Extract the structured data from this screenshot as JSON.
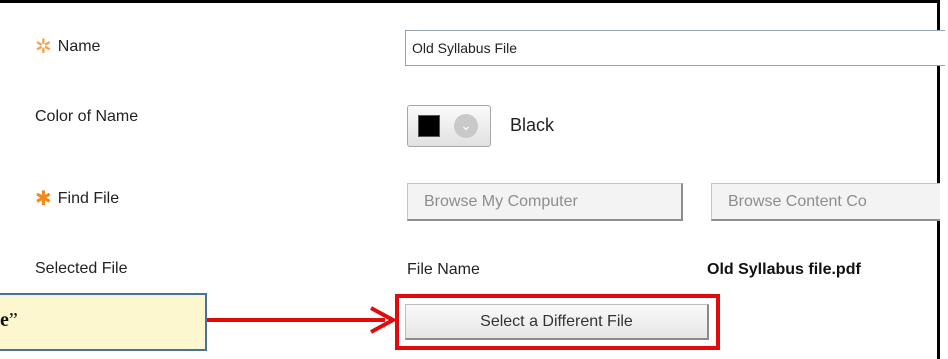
{
  "form": {
    "name_label": "Name",
    "name_value": "Old Syllabus File",
    "color_label": "Color of Name",
    "color_value": "Black",
    "color_swatch": "#000000",
    "find_file_label": "Find File",
    "browse_my_computer": "Browse My Computer",
    "browse_content": "Browse Content Co",
    "selected_file_label": "Selected File",
    "file_name_label": "File Name",
    "file_name_value": "Old Syllabus file.pdf",
    "select_different": "Select a Different File"
  },
  "callout": {
    "text": "e",
    "quote": "”"
  },
  "colors": {
    "required_star": "#f08a1c",
    "highlight_border": "#e20b0b",
    "callout_bg": "#fcf7cf",
    "callout_border": "#4a6fa5"
  },
  "icons": {
    "required": "asterisk-icon",
    "dropdown": "chevron-down-icon",
    "arrow": "red-arrow"
  }
}
